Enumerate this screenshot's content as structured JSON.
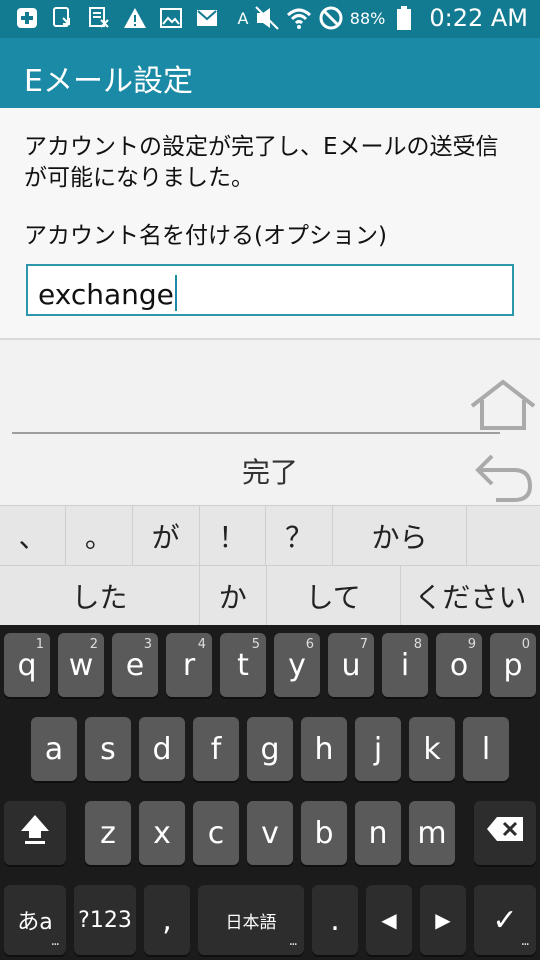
{
  "status_bar": {
    "battery_percent": "88%",
    "time": "0:22 AM",
    "left_icons": [
      "plus-icon",
      "download-icon",
      "document-icon",
      "warning-icon",
      "image-icon",
      "mail-icon",
      "a-icon"
    ],
    "right_icons": [
      "mute-icon",
      "wifi-icon",
      "block-icon",
      "battery-icon"
    ]
  },
  "app_bar": {
    "title": "Eメール設定"
  },
  "content": {
    "message": "アカウントの設定が完了し、Eメールの送受信が可能になりました。",
    "account_name_label": "アカウント名を付ける(オプション)",
    "account_name_value": "exchange"
  },
  "actions": {
    "done_label": "完了"
  },
  "suggestions": {
    "row1": [
      "、",
      "。",
      "が",
      "！",
      "？",
      "から"
    ],
    "row2": [
      "した",
      "か",
      "して",
      "ください"
    ]
  },
  "keyboard": {
    "row1": [
      {
        "label": "q",
        "hint": "1"
      },
      {
        "label": "w",
        "hint": "2"
      },
      {
        "label": "e",
        "hint": "3"
      },
      {
        "label": "r",
        "hint": "4"
      },
      {
        "label": "t",
        "hint": "5"
      },
      {
        "label": "y",
        "hint": "6"
      },
      {
        "label": "u",
        "hint": "7"
      },
      {
        "label": "i",
        "hint": "8"
      },
      {
        "label": "o",
        "hint": "9"
      },
      {
        "label": "p",
        "hint": "0"
      }
    ],
    "row2": [
      "a",
      "s",
      "d",
      "f",
      "g",
      "h",
      "j",
      "k",
      "l"
    ],
    "row3": [
      "z",
      "x",
      "c",
      "v",
      "b",
      "n",
      "m"
    ],
    "bottom": {
      "mode_label": "あa",
      "num_label": "?123",
      "comma_label": ",",
      "lang_label": "日本語",
      "period_label": ".",
      "left_label": "◀",
      "right_label": "▶",
      "enter_label": "✓"
    }
  }
}
